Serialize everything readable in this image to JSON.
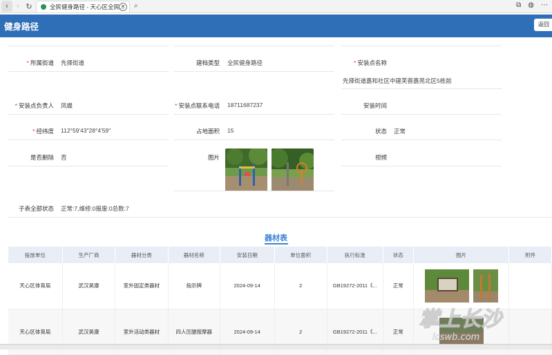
{
  "browser": {
    "tab_title": "全民健身路径 - 天心区全民...",
    "nav": {
      "back": "‹",
      "forward": "›",
      "refresh": "↻",
      "search": "🔍"
    }
  },
  "header": {
    "title": "健身路径",
    "back_label": "返回"
  },
  "form": {
    "street_label": "所属街道",
    "street_value": "先择街道",
    "archive_type_label": "建档类型",
    "archive_type_value": "全民健身路径",
    "site_name_label": "安装点名称",
    "site_name_value": "先择街道嘉和社区中建芙蓉嘉苑北区5栋前",
    "manager_label": "安装点负责人",
    "manager_value": "凤蝶",
    "phone_label": "安装点联系电话",
    "phone_value": "18711687237",
    "install_time_label": "安装时间",
    "install_time_value": "",
    "coords_label": "经纬度",
    "coords_value": "112°59'43\"28°4'59\"",
    "area_label": "占地面积",
    "area_value": "15",
    "state_label": "状态",
    "state_value": "正常",
    "deleted_label": "是否删除",
    "deleted_value": "否",
    "pictures_label": "图片",
    "video_label": "视频",
    "sub_status_label": "子表全部状态",
    "sub_status_value": "正常:7,维修:0报废:0总数:7"
  },
  "equipment": {
    "section_title": "器材表",
    "columns": [
      "投放单位",
      "生产厂商",
      "器材分类",
      "器材名称",
      "安装日期",
      "单位面积",
      "执行标准",
      "状态",
      "图片",
      "附件"
    ],
    "rows": [
      [
        "天心区体育局",
        "武汉昊康",
        "室外固定类器材",
        "指示牌",
        "2024-09-14",
        "2",
        "GB19272-2011《...",
        "正常"
      ],
      [
        "天心区体育局",
        "武汉昊康",
        "室外活动类器材",
        "四人压腿按摩器",
        "2024-09-14",
        "2",
        "GB19272-2011《...",
        "正常"
      ]
    ]
  },
  "watermark": {
    "text": "掌上长沙",
    "sub": "icswb.com"
  },
  "colors": {
    "header": "#2f6fb8",
    "accent": "#3b80d6",
    "required": "#e33333"
  }
}
